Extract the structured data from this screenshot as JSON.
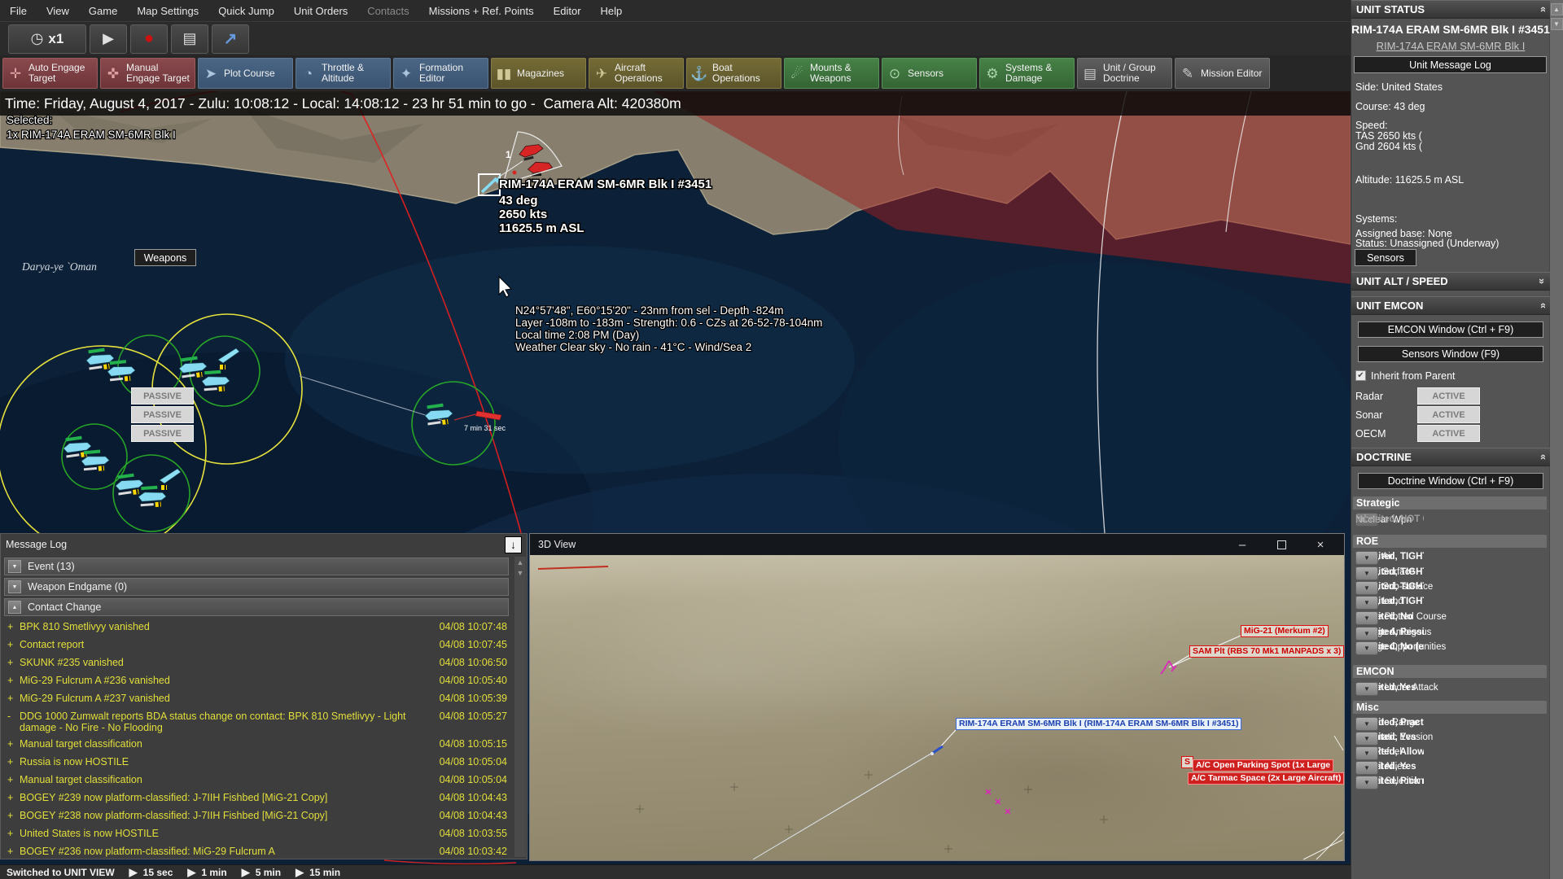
{
  "colors": {
    "accent_yellow": "#e3df3b",
    "hostile_red": "#cc2222",
    "friendly_cyan": "#7fd9f2",
    "sensor_green": "#27a527",
    "systems_ok_green": "#129012",
    "exclusion_zone_red": "rgba(160,30,30,0.5)",
    "sidebar_gray": "#545454",
    "toolbar_engage": "#7d4145",
    "toolbar_nav": "#44607e",
    "toolbar_ops": "#6f6633",
    "toolbar_systems": "#447d44"
  },
  "icons": {
    "clock": "◷",
    "play": "▶",
    "record": "●",
    "layers": "▤",
    "jump_arrow": "↗",
    "chevron_double": "»",
    "scroll_up": "▲",
    "scroll_down": "▼",
    "dropdown": "▼",
    "check": "✔",
    "log_jump": "↓",
    "collapse_down": "▼",
    "collapse_up": "▲"
  },
  "menu": {
    "items": [
      {
        "label": "File"
      },
      {
        "label": "View"
      },
      {
        "label": "Game"
      },
      {
        "label": "Map Settings"
      },
      {
        "label": "Quick Jump"
      },
      {
        "label": "Unit Orders"
      },
      {
        "label": "Contacts"
      },
      {
        "label": "Missions + Ref. Points"
      },
      {
        "label": "Editor"
      },
      {
        "label": "Help"
      }
    ]
  },
  "toolbar_primary": {
    "time_compression": "x1"
  },
  "toolbar_actions": [
    {
      "label": "Auto Engage Target",
      "icon": "✛"
    },
    {
      "label": "Manual Engage Target",
      "icon": "✜"
    },
    {
      "label": "Plot Course",
      "icon": "➤"
    },
    {
      "label": "Throttle & Altitude",
      "icon": "◔"
    },
    {
      "label": "Formation Editor",
      "icon": "✦"
    },
    {
      "label": "Magazines",
      "icon": "▮▮"
    },
    {
      "label": "Aircraft Operations",
      "icon": "✈"
    },
    {
      "label": "Boat Operations",
      "icon": "⚓"
    },
    {
      "label": "Mounts & Weapons",
      "icon": "☄"
    },
    {
      "label": "Sensors",
      "icon": "⊙"
    },
    {
      "label": "Systems & Damage",
      "icon": "⚙"
    },
    {
      "label": "Unit / Group Doctrine",
      "icon": "▤"
    },
    {
      "label": "Mission Editor",
      "icon": "✎"
    }
  ],
  "timebar": {
    "text": "Time: Friday, August 4, 2017 - Zulu: 10:08:12 - Local: 14:08:12 - 23 hr 51 min to go -  Camera Alt: 420380m"
  },
  "map": {
    "selected_heading": "Selected:",
    "selected_unit": "1x RIM-174A ERAM SM-6MR Blk I",
    "sea_label": "Darya-ye `Oman",
    "wedge_number": "1",
    "eta_label": "7 min 31 sec",
    "unit_label": {
      "line1": "RIM-174A ERAM SM-6MR Blk I #3451",
      "line2": "43 deg",
      "line3": "2650 kts",
      "line4": "11625.5 m ASL"
    },
    "tooltip": {
      "line1": "N24°57'48\", E60°15'20\" - 23nm from sel - Depth -824m",
      "line2": "Layer -108m to -183m - Strength: 0.6 - CZs at 26-52-78-104nm",
      "line3": "Local time 2:08 PM (Day)",
      "line4": "Weather Clear sky - No rain - 41°C - Wind/Sea 2"
    }
  },
  "message_log": {
    "title": "Message Log",
    "groups": [
      {
        "label": "Event (13)",
        "state": "collapsed"
      },
      {
        "label": "Weapon Endgame (0)",
        "state": "collapsed"
      },
      {
        "label": "Contact Change",
        "state": "expanded"
      }
    ],
    "entries": [
      {
        "prefix": "+",
        "text": "BPK 810 Smetlivyy vanished",
        "time": "04/08 10:07:48"
      },
      {
        "prefix": "+",
        "text": "Contact report",
        "time": "04/08 10:07:45"
      },
      {
        "prefix": "+",
        "text": "SKUNK #235 vanished",
        "time": "04/08 10:06:50"
      },
      {
        "prefix": "+",
        "text": "MiG-29 Fulcrum A #236 vanished",
        "time": "04/08 10:05:40"
      },
      {
        "prefix": "+",
        "text": "MiG-29 Fulcrum A #237 vanished",
        "time": "04/08 10:05:39"
      },
      {
        "prefix": "-",
        "text": "DDG 1000 Zumwalt reports BDA status change on contact: BPK 810 Smetlivyy - Light damage - No Fire - No Flooding",
        "time": "04/08 10:05:27"
      },
      {
        "prefix": "+",
        "text": "Manual target classification",
        "time": "04/08 10:05:15"
      },
      {
        "prefix": "+",
        "text": "Russia is now HOSTILE",
        "time": "04/08 10:05:04"
      },
      {
        "prefix": "+",
        "text": "Manual target classification",
        "time": "04/08 10:05:04"
      },
      {
        "prefix": "+",
        "text": "BOGEY #239 now platform-classified: J-7IIH Fishbed [MiG-21 Copy]",
        "time": "04/08 10:04:43"
      },
      {
        "prefix": "+",
        "text": "BOGEY #238 now platform-classified: J-7IIH Fishbed [MiG-21 Copy]",
        "time": "04/08 10:04:43"
      },
      {
        "prefix": "+",
        "text": "United States is now HOSTILE",
        "time": "04/08 10:03:55"
      },
      {
        "prefix": "+",
        "text": "BOGEY #236 now platform-classified: MiG-29 Fulcrum A",
        "time": "04/08 10:03:42"
      }
    ]
  },
  "view3d": {
    "title": "3D View",
    "controls": {
      "minimize": "–",
      "close": "×"
    },
    "labels": {
      "mig": "MiG-21 (Merkum #2)",
      "sam": "SAM Plt (RBS 70 Mk1 MANPADS x 3)",
      "missile": "RIM-174A ERAM SM-6MR Blk I (RIM-174A ERAM SM-6MR Blk I #3451)",
      "stray": "S",
      "parking": "A/C Open Parking Spot (1x Large",
      "tarmac": "A/C Tarmac Space (2x Large Aircraft)"
    }
  },
  "bottom_bar": {
    "status": "Switched to UNIT VIEW",
    "time_steps": [
      "15 sec",
      "1 min",
      "5 min",
      "15 min"
    ]
  },
  "sidebar": {
    "unit_status": {
      "header": "UNIT STATUS",
      "title": "RIM-174A ERAM SM-6MR Blk I #3451",
      "link": "RIM-174A ERAM SM-6MR Blk I",
      "message_log_button": "Unit Message Log",
      "side": "Side: United States",
      "course": "Course: 43 deg",
      "speed_label": "Speed:",
      "tas": "TAS 2650 kts (",
      "gnd": "Gnd 2604 kts (",
      "altitude": "Altitude: 11625.5 m ASL",
      "systems_label": "Systems:",
      "assigned_base": "Assigned base: None",
      "status": "Status: Unassigned (Underway)",
      "sensors_button": "Sensors",
      "weapons_button": "Weapons"
    },
    "unit_alt_speed": {
      "header": "UNIT ALT / SPEED"
    },
    "unit_emcon": {
      "header": "UNIT EMCON",
      "emcon_window": "EMCON Window (Ctrl + F9)",
      "sensors_window": "Sensors Window (F9)",
      "inherit": "Inherit from Parent",
      "rows": [
        {
          "label": "Radar",
          "active": "ACTIVE",
          "passive": "PASSIVE"
        },
        {
          "label": "Sonar",
          "active": "ACTIVE",
          "passive": "PASSIVE"
        },
        {
          "label": "OECM",
          "active": "ACTIVE",
          "passive": "PASSIVE"
        }
      ]
    },
    "doctrine": {
      "header": "DOCTRINE",
      "window_button": "Doctrine Window (Ctrl + F9)",
      "strategic_title": "Strategic",
      "nuclear": {
        "label": "Nuclear Wpn",
        "value": "Inherited, NOT G"
      },
      "roe_title": "ROE",
      "roe_rows": [
        {
          "label": "WCS, Air",
          "value": "Inherited, TIGHT"
        },
        {
          "label": "WCS, Surface",
          "value": "Inherited, TIGHT"
        },
        {
          "label": "WCS, Sub-surface",
          "value": "Inherited, TIGHT"
        },
        {
          "label": "WCS, Land",
          "value": "Inherited, TIGHT"
        },
        {
          "label": "Ignore Plotted Course",
          "value": "Inherited, No"
        },
        {
          "label": "Engage Ambigous",
          "value": "Inherited, Pessim"
        },
        {
          "label": "Engage Opportunities",
          "value": "Inherited, No (en"
        }
      ],
      "emcon_title": "EMCON",
      "emcon_rows": [
        {
          "label": "Ignore Under Attack",
          "value": "Inherited, Yes"
        }
      ],
      "misc_title": "Misc",
      "misc_rows": [
        {
          "label": "Torpedo Range",
          "value": "Inherited, Practic"
        },
        {
          "label": "Automatic Evasion",
          "value": "Inherited, Yes"
        },
        {
          "label": "Use Refuel",
          "value": "Inherited, Allow, I"
        },
        {
          "label": "Refuel Allies",
          "value": "Inherited, Yes"
        },
        {
          "label": "Refuel Selection",
          "value": "Inherited, Pick ne"
        }
      ]
    }
  }
}
